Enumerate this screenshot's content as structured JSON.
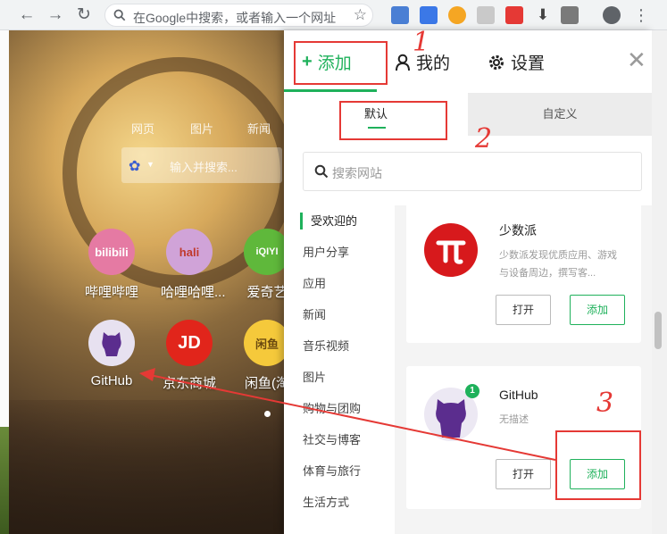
{
  "browser": {
    "omnibox_placeholder": "在Google中搜索，或者输入一个网址",
    "back_icon": "arrow-left-icon",
    "forward_icon": "arrow-right-icon",
    "reload_icon": "reload-icon"
  },
  "background_page": {
    "tabs": [
      "网页",
      "图片",
      "新闻"
    ],
    "search_placeholder": "输入并搜索...",
    "tiles": [
      {
        "label": "哔哩哔哩",
        "logo_text": "bilibili",
        "color": "#e57aa3"
      },
      {
        "label": "哈哩哈哩...",
        "logo_text": "hali",
        "color": "#d0a3d8"
      },
      {
        "label": "爱奇艺",
        "logo_text": "iQIYI",
        "color": "#5fb83b"
      },
      {
        "label": "GitHub",
        "logo_text": "",
        "color": "#e7e1f0"
      },
      {
        "label": "京东商城",
        "logo_text": "JD",
        "color": "#e1251b"
      },
      {
        "label": "闲鱼(淘",
        "logo_text": "闲鱼",
        "color": "#f5c93b"
      }
    ]
  },
  "panel": {
    "tabs": [
      {
        "label": "添加",
        "icon": "plus-icon",
        "active": true
      },
      {
        "label": "我的",
        "icon": "user-icon",
        "active": false
      },
      {
        "label": "设置",
        "icon": "gear-icon",
        "active": false
      }
    ],
    "subtabs": [
      "默认",
      "自定义"
    ],
    "search_placeholder": "搜索网站",
    "categories": [
      "受欢迎的",
      "用户分享",
      "应用",
      "新闻",
      "音乐视频",
      "图片",
      "购物与团购",
      "社交与博客",
      "体育与旅行",
      "生活方式"
    ],
    "cards": [
      {
        "name": "少数派",
        "desc": "少数派发现优质应用、游戏与设备周边，撰写客...",
        "open": "打开",
        "add": "添加"
      },
      {
        "name": "GitHub",
        "desc": "无描述",
        "badge": "1",
        "open": "打开",
        "add": "添加"
      }
    ]
  },
  "annotations": {
    "marks": [
      "1",
      "2",
      "3"
    ]
  },
  "colors": {
    "accent": "#1fb15b",
    "annotation": "#e53935"
  }
}
